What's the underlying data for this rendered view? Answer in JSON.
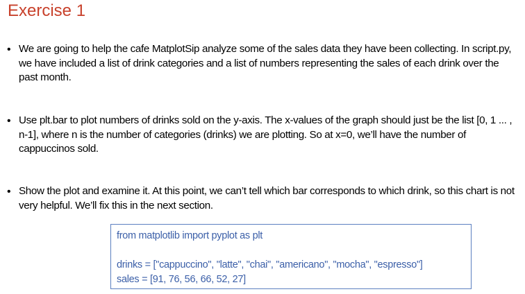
{
  "title": "Exercise 1",
  "bullets": [
    {
      "marker": "•",
      "text": "We are going to help the cafe MatplotSip analyze some of the sales data they have been collecting. In script.py, we have included a list of drink categories and a list of numbers representing the sales of each drink over the past month."
    },
    {
      "marker": "•",
      "text": "Use plt.bar to plot numbers of drinks sold on the y-axis. The x-values of the graph should just be the list [0, 1 ... , n-1], where n is the number of categories (drinks) we are plotting. So at x=0, we’ll have the number of cappuccinos sold."
    },
    {
      "marker": "•",
      "text": "Show the plot and examine it. At this point, we can’t tell which bar corresponds to which drink, so this chart is not very helpful. We’ll fix this in the next section."
    }
  ],
  "code": {
    "import_line": "from matplotlib import pyplot as plt",
    "drinks_line": "drinks = [\"cappuccino\", \"latte\", \"chai\", \"americano\", \"mocha\", \"espresso\"]",
    "sales_line": "sales =  [91, 76, 56, 66, 52, 27]"
  },
  "colors": {
    "title": "#c8412b",
    "code_text": "#3b5fa8",
    "code_border": "#5b7fc0"
  }
}
